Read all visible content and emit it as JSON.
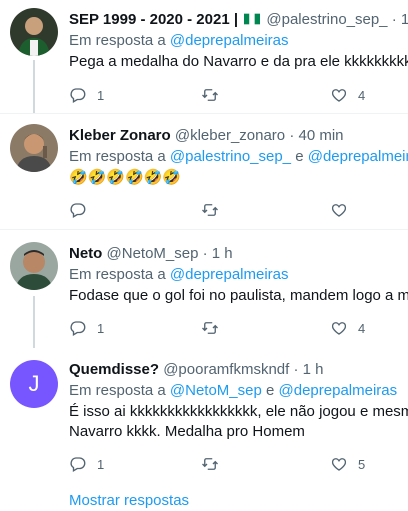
{
  "tweets": [
    {
      "name": "SEP 1999 - 2020 - 2021 |",
      "flag": "nigeria-flag-emoji",
      "handle": "@palestrino_sep_",
      "time": "· 1",
      "replying_prefix": "Em resposta a ",
      "mentions": [
        "@deprepalmeiras"
      ],
      "text": "Pega a medalha do Navarro e da pra ele kkkkkkkkkk",
      "reply_count": "1",
      "retweet_count": "",
      "like_count": "4"
    },
    {
      "name": "Kleber Zonaro",
      "handle": "@kleber_zonaro",
      "time": "· 40 min",
      "replying_prefix": "Em resposta a ",
      "mentions": [
        "@palestrino_sep_",
        "@deprepalmeiras"
      ],
      "mention_joiner": " e ",
      "text": "🤣🤣🤣🤣🤣🤣",
      "reply_count": "",
      "retweet_count": "",
      "like_count": ""
    },
    {
      "name": "Neto",
      "handle": "@NetoM_sep",
      "time": "· 1 h",
      "replying_prefix": "Em resposta a ",
      "mentions": [
        "@deprepalmeiras"
      ],
      "text": "Fodase que o gol foi no paulista, mandem logo a med",
      "reply_count": "1",
      "retweet_count": "",
      "like_count": "4"
    },
    {
      "name": "Quemdisse?",
      "handle": "@pooramfkmskndf",
      "time": "· 1 h",
      "avatar_letter": "J",
      "replying_prefix": "Em resposta a ",
      "mentions": [
        "@NetoM_sep",
        "@deprepalmeiras"
      ],
      "mention_joiner": " e ",
      "text_line1": "É isso ai kkkkkkkkkkkkkkkkk, ele não jogou e mesmo",
      "text_line2": "Navarro kkkk. Medalha pro Homem",
      "reply_count": "1",
      "retweet_count": "",
      "like_count": "5"
    }
  ],
  "show_replies": "Mostrar respostas",
  "colors": {
    "accent": "#1d9bf0",
    "secondary_text": "#536471",
    "avatar_purple": "#7856ff"
  }
}
